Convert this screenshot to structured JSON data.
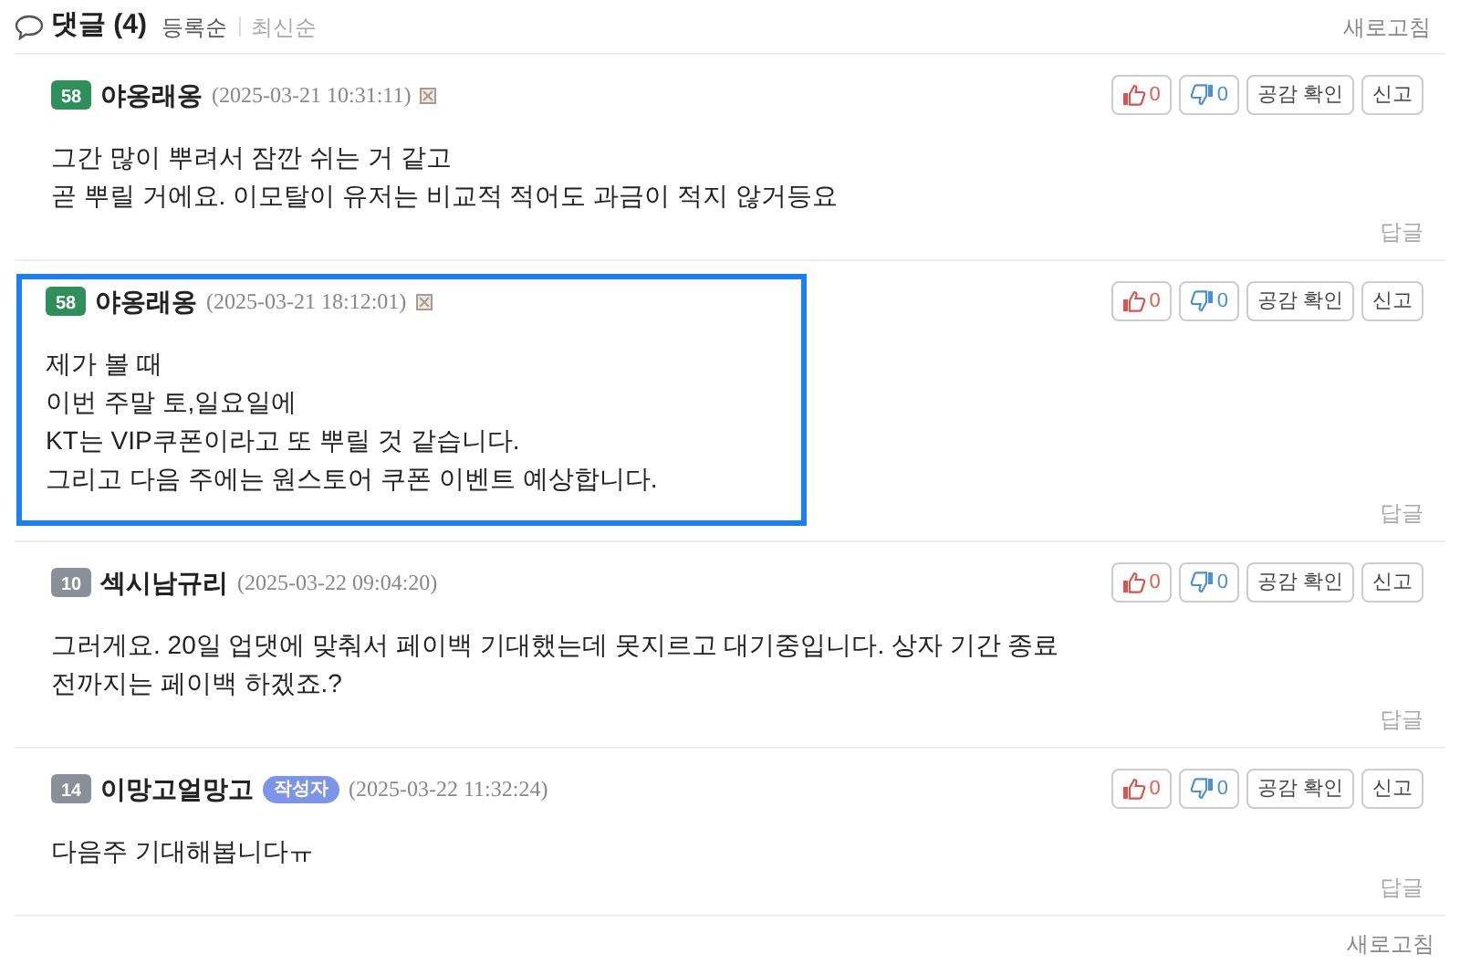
{
  "header": {
    "title": "댓글",
    "count": "(4)",
    "sorts": [
      {
        "label": "등록순",
        "selected": true
      },
      {
        "label": "최신순",
        "selected": false
      }
    ],
    "refresh": "새로고침"
  },
  "comments": [
    {
      "badge": "58",
      "color": "#2f8f5b",
      "author": "야옹래옹",
      "date": "(2025-03-21 10:31:11)",
      "block_icon": true,
      "highlighted": false,
      "lines": [
        "그간 많이 뿌려서 잠깐 쉬는 거 같고",
        "곧 뿌릴 거에요. 이모탈이 유저는 비교적 적어도 과금이 적지 않거등요"
      ],
      "like": "0",
      "dislike": "0",
      "empathy": "공감 확인",
      "report": "신고",
      "reply": "답글"
    },
    {
      "badge": "58",
      "color": "#2f8f5b",
      "author": "야옹래옹",
      "date": "(2025-03-21 18:12:01)",
      "block_icon": true,
      "highlighted": true,
      "lines": [
        "제가 볼 때",
        "이번 주말 토,일요일에",
        "KT는 VIP쿠폰이라고 또 뿌릴 것 같습니다.",
        "그리고 다음 주에는 원스토어 쿠폰 이벤트 예상합니다."
      ],
      "like": "0",
      "dislike": "0",
      "empathy": "공감 확인",
      "report": "신고",
      "reply": "답글"
    },
    {
      "badge": "10",
      "color": "#8a8f99",
      "author": "섹시남규리",
      "date": "(2025-03-22 09:04:20)",
      "block_icon": false,
      "highlighted": false,
      "lines": [
        "그러게요. 20일 업댓에 맞춰서 페이백 기대했는데 못지르고 대기중입니다. 상자 기간 종료",
        "전까지는 페이백 하겠죠.?"
      ],
      "like": "0",
      "dislike": "0",
      "empathy": "공감 확인",
      "report": "신고",
      "reply": "답글"
    },
    {
      "badge": "14",
      "color": "#8a8f99",
      "author": "이망고얼망고",
      "author_tag": "작성자",
      "date": "(2025-03-22 11:32:24)",
      "block_icon": false,
      "highlighted": false,
      "lines": [
        "다음주 기대해봅니다ㅠ"
      ],
      "like": "0",
      "dislike": "0",
      "empathy": "공감 확인",
      "report": "신고",
      "reply": "답글"
    }
  ],
  "footer": {
    "refresh": "새로고침"
  }
}
